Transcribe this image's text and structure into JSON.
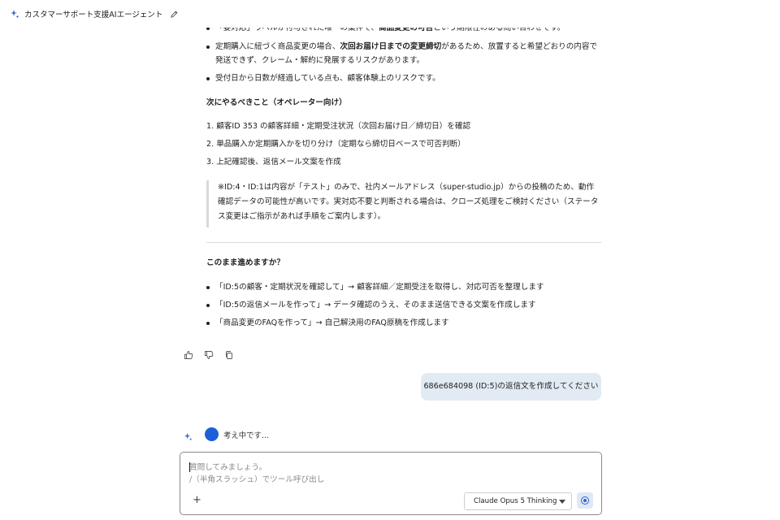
{
  "header": {
    "title": "カスタマーサポート支援AIエージェント",
    "logo_icon": "sparkle-icon",
    "edit_icon": "pencil-icon"
  },
  "message": {
    "bullets_top": [
      {
        "pre": "「要対応」ラベルが付与された唯一の案件で、",
        "bold": "商品変更の可否",
        "post": "という期限性のある問い合わせです。"
      },
      {
        "pre": "定期購入に紐づく商品変更の場合、",
        "bold": "次回お届け日までの変更締切",
        "post": "があるため、放置すると希望どおりの内容で発送できず、クレーム・解約に発展するリスクがあります。"
      },
      {
        "pre": "受付日から日数が経過している点も、顧客体験上のリスクです。",
        "bold": "",
        "post": ""
      }
    ],
    "next_heading": "次にやるべきこと（オペレーター向け）",
    "steps": [
      "1. 顧客ID 353 の顧客詳細・定期受注状況（次回お届け日／締切日）を確認",
      "2. 単品購入か定期購入かを切り分け（定期なら締切日ベースで可否判断）",
      "3. 上記確認後、返信メール文案を作成"
    ],
    "note": "※ID:4・ID:1は内容が「テスト」のみで、社内メールアドレス（super-studio.jp）からの投稿のため、動作確認データの可能性が高いです。実対応不要と判断される場合は、クローズ処理をご検討ください（ステータス変更はご指示があれば手順をご案内します）。",
    "proceed_heading": "このまま進めますか？",
    "options": [
      "「ID:5の顧客・定期状況を確認して」→ 顧客詳細／定期受注を取得し、対応可否を整理します",
      "「ID:5の返信メールを作って」→ データ確認のうえ、そのまま送信できる文案を作成します",
      "「商品変更のFAQを作って」→ 自己解決用のFAQ原稿を作成します"
    ]
  },
  "actions": {
    "icons": [
      "thumbs-up-icon",
      "thumbs-down-icon",
      "copy-icon"
    ]
  },
  "user_message": "686e684098 (ID:5)の返信文を作成してください",
  "thinking": {
    "text": "考え中です…"
  },
  "composer": {
    "placeholder_line1": "質問してみましょう。",
    "placeholder_line2": "/（半角スラッシュ）でツール呼び出し",
    "plus_label": "+",
    "model_label": "Claude Opus 5 Thinking",
    "accent": "#2f63d3"
  }
}
